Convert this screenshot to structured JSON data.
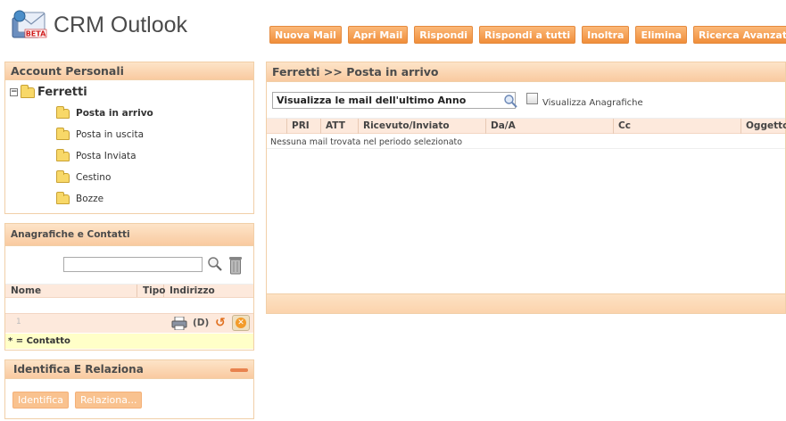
{
  "app": {
    "title": "CRM Outlook",
    "logo_badge": "BETA"
  },
  "toolbar": {
    "buttons": [
      "Nuova Mail",
      "Apri Mail",
      "Rispondi",
      "Rispondi a tutti",
      "Inoltra",
      "Elimina",
      "Ricerca Avanzata"
    ]
  },
  "account": {
    "title": "Account Personali",
    "root": "Ferretti",
    "folders": [
      "Posta in arrivo",
      "Posta in uscita",
      "Posta Inviata",
      "Cestino",
      "Bozze"
    ],
    "selected": "Posta in arrivo"
  },
  "anagrafiche": {
    "title": "Anagrafiche e Contatti",
    "search_value": "",
    "columns": [
      "Nome",
      "Tipo",
      "Indirizzo"
    ],
    "pager": "1",
    "d_label": "(D)",
    "legend": "* = Contatto"
  },
  "identifica": {
    "title": "Identifica E Relaziona",
    "identifica_label": "Identifica",
    "relaziona_label": "Relaziona..."
  },
  "main": {
    "breadcrumb": "Ferretti >> Posta in arrivo",
    "filter": "Visualizza le mail dell'ultimo Anno",
    "show_anagrafiche_label": "Visualizza Anagrafiche",
    "show_anagrafiche_checked": false,
    "columns": [
      "PRI",
      "ATT",
      "Ricevuto/Inviato",
      "Da/A",
      "Cc",
      "Oggetto"
    ],
    "empty_message": "Nessuna mail trovata nel periodo selezionato"
  },
  "colors": {
    "accent": "#f39c4f",
    "panel_header": "#fbd3ac",
    "border": "#f1cfa8"
  }
}
